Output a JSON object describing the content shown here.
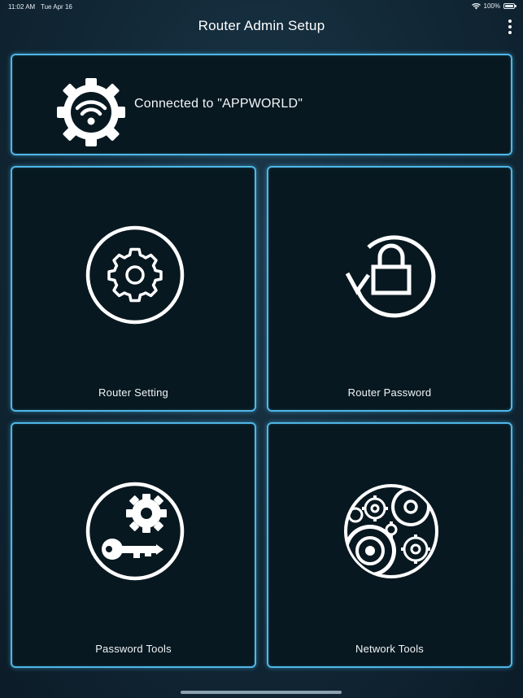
{
  "status_bar": {
    "time": "11:02 AM",
    "date": "Tue Apr 16",
    "battery": "100%",
    "wifi_icon": "wifi-icon",
    "battery_icon": "battery-icon"
  },
  "header": {
    "title": "Router Admin Setup",
    "menu_icon": "more-vertical-icon"
  },
  "connection": {
    "text": "Connected to \"APPWORLD\"",
    "icon": "wifi-gear-icon"
  },
  "tiles": [
    {
      "label": "Router Setting",
      "icon": "gear-icon"
    },
    {
      "label": "Router Password",
      "icon": "lock-reset-icon"
    },
    {
      "label": "Password Tools",
      "icon": "key-gear-icon"
    },
    {
      "label": "Network Tools",
      "icon": "network-gears-icon"
    }
  ],
  "colors": {
    "background": "#132a39",
    "card_bg": "#081820",
    "card_border": "#4fb7e6",
    "text": "#ffffff"
  }
}
